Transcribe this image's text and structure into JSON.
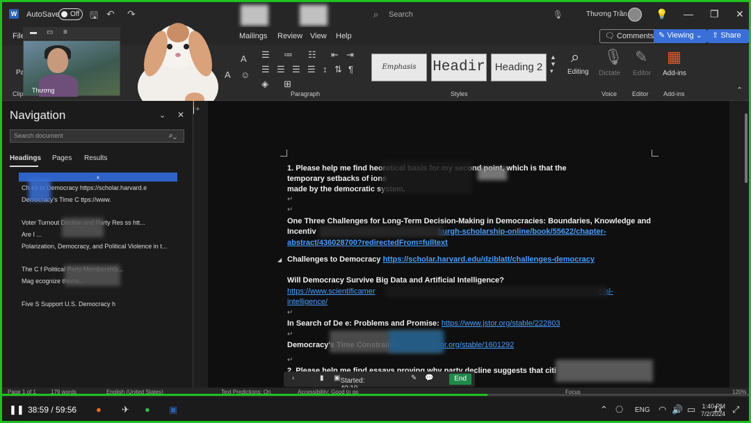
{
  "titlebar": {
    "app_icon": "W",
    "autosave_label": "AutoSave",
    "autosave_state": "Off",
    "search_placeholder": "Search",
    "user_name": "Thương Trần"
  },
  "menu": {
    "items": [
      "File",
      "Mailings",
      "Review",
      "View",
      "Help"
    ],
    "comments_label": "Comments",
    "viewing_label": "Viewing",
    "share_label": "Share"
  },
  "ribbon": {
    "groups": {
      "clipboard": "Clipboard",
      "paragraph": "Paragraph",
      "styles": "Styles",
      "voice": "Voice",
      "editor": "Editor",
      "addins": "Add-ins"
    },
    "styles": [
      "Emphasis",
      "Headir",
      "Heading 2"
    ],
    "editing_label": "Editing",
    "dictate_label": "Dictate",
    "editor_label": "Editor",
    "addins_label": "Add-ins",
    "paste_label": "Pa"
  },
  "webcam": {
    "participant_name": "Thương"
  },
  "navigation": {
    "title": "Navigation",
    "search_placeholder": "Search document",
    "tabs": [
      "Headings",
      "Pages",
      "Results"
    ],
    "active_tab": "Headings",
    "headings": [
      "Ch        es to Democracy https://scholar.harvard.e",
      "Democracy's Time C                   ttps://www.",
      "Voter Turnout Decline and Party Res             ss htt...",
      "Are I                                                    ...",
      "Polarization, Democracy, and Political Violence in t...",
      "The C                          f Political Party Membership...",
      "Mag                              ecognize thems...",
      "Five S                   Support U.S. Democracy h"
    ]
  },
  "document": {
    "item1_line1": "1. Please help me find                                    heoretical basis for my second point, which is that the",
    "item1_line2": "temporary setbacks of                                                                                                 ions",
    "item1_line3": "made by the democratic system.",
    "src1_line1": "One Three Challenges for Long-Term Decision-Making in Democracies: Boundaries, Knowledge and",
    "src1_line2_text": "Incentiv",
    "src1_line2_link": "burgh-scholarship-online/book/55622/chapter-",
    "src1_line3_link": "abstract/436028700?redirectedFrom=fulltext",
    "src2_text": "Challenges to Democracy",
    "src2_link": "https://scholar.harvard.edu/dziblatt/challenges-democracy",
    "src3_title": "Will Democracy Survive Big Data and Artificial Intelligence?",
    "src3_link1": "https://www.scientificamer",
    "src3_link1b": "cial-",
    "src3_link2": "intelligence/",
    "src4_text": "In Search of De                  e: Problems and Promise:",
    "src4_link": "https://www.jstor.org/stable/222803",
    "src5_text": "Democracy's Time Constraints",
    "src5_link": "jstor.org/stable/1601292",
    "item2_line1": "2. Please help me find essays proving why party decline suggests that citi"
  },
  "overlay_toolbar": {
    "started_label": "Started: 40:10",
    "end_label": "End"
  },
  "statusbar": {
    "page": "Page 1 of 1",
    "words": "179 words",
    "language": "English (United States)",
    "predictions": "Text Predictions: On",
    "accessibility": "Accessibility: Good to go",
    "focus": "Focus",
    "zoom": "120%"
  },
  "player": {
    "time": "38:59 / 59:56",
    "progress_fraction": 0.65,
    "speed": "1x"
  },
  "taskbar": {
    "lang": "ENG",
    "time": "1:40 PM",
    "date": "7/2/2024"
  }
}
